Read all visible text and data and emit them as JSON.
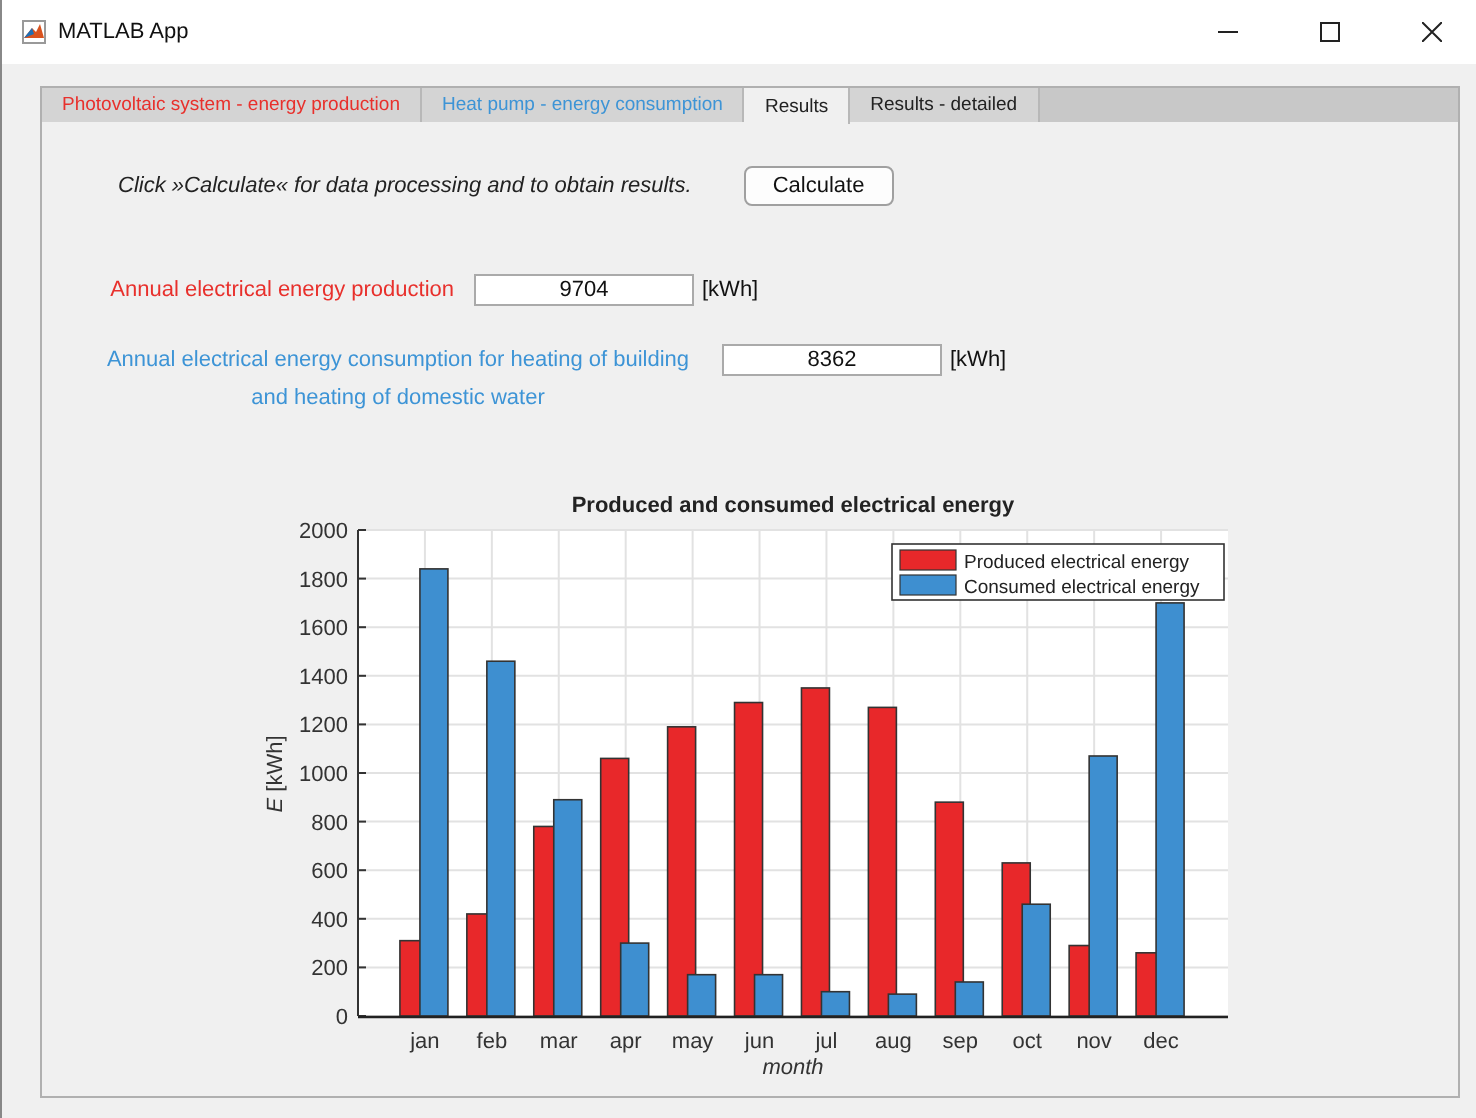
{
  "window": {
    "title": "MATLAB App"
  },
  "tabs": [
    {
      "label": "Photovoltaic system - energy production",
      "selected": false,
      "color": "#e8302c"
    },
    {
      "label": "Heat pump - energy consumption",
      "selected": false,
      "color": "#3d94d6"
    },
    {
      "label": "Results",
      "selected": true,
      "color": "#222222"
    },
    {
      "label": "Results - detailed",
      "selected": false,
      "color": "#222222"
    }
  ],
  "instruction": "Click »Calculate« for data processing and to obtain results.",
  "calculate_button": "Calculate",
  "results": [
    {
      "label": "Annual electrical energy production",
      "value": "9704",
      "unit": "[kWh]",
      "color": "#e8302c"
    },
    {
      "label": "Annual electrical energy consumption for heating of building and heating of domestic water",
      "value": "8362",
      "unit": "[kWh]",
      "color": "#3d94d6"
    }
  ],
  "chart": {
    "chart_data": {
      "type": "bar",
      "title": "Produced and consumed electrical energy",
      "xlabel": "month",
      "ylabel": "*E* [kWh]",
      "categories": [
        "jan",
        "feb",
        "mar",
        "apr",
        "may",
        "jun",
        "jul",
        "aug",
        "sep",
        "oct",
        "nov",
        "dec"
      ],
      "series": [
        {
          "name": "Produced electrical energy",
          "color": "#e8282a",
          "values": [
            310,
            420,
            780,
            1060,
            1190,
            1290,
            1350,
            1270,
            880,
            630,
            290,
            260
          ]
        },
        {
          "name": "Consumed electrical energy",
          "color": "#3e8fd0",
          "values": [
            1840,
            1460,
            890,
            300,
            170,
            170,
            100,
            90,
            140,
            460,
            1070,
            1700
          ]
        }
      ],
      "grid": true,
      "legend": true,
      "ylim": [
        0,
        2000
      ],
      "yticks": [
        0,
        200,
        400,
        600,
        800,
        1000,
        1200,
        1400,
        1600,
        1800,
        2000
      ]
    }
  }
}
